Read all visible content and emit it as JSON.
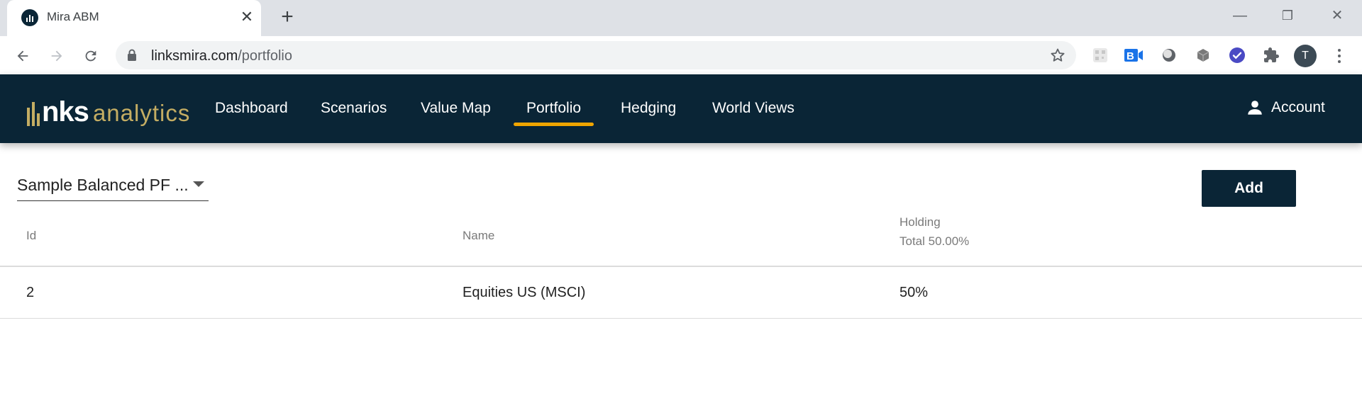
{
  "browser": {
    "tab_title": "Mira ABM",
    "tab_close": "✕",
    "new_tab": "+",
    "url_host": "linksmira.com",
    "url_path": "/portfolio",
    "profile_initial": "T",
    "window_controls": {
      "minimize": "—",
      "restore": "❐",
      "close": "✕"
    },
    "extensions": [
      "qr-icon",
      "video-meeting-icon",
      "disc-icon",
      "cube-icon",
      "check-circle-icon",
      "puzzle-icon"
    ]
  },
  "app": {
    "logo": {
      "brand": "nks",
      "suffix": "analytics"
    },
    "nav": [
      {
        "label": "Dashboard"
      },
      {
        "label": "Scenarios"
      },
      {
        "label": "Value Map"
      },
      {
        "label": "Portfolio",
        "active": true
      },
      {
        "label": "Hedging"
      },
      {
        "label": "World Views"
      }
    ],
    "account_label": "Account",
    "colors": {
      "header_bg": "#0a2536",
      "accent": "#f0a500",
      "logo_gold": "#c4ad63"
    }
  },
  "portfolio": {
    "selected": "Sample Balanced PF ...",
    "add_label": "Add",
    "columns": {
      "id": "Id",
      "name": "Name",
      "holding": "Holding",
      "holding_total": "Total 50.00%"
    },
    "rows": [
      {
        "id": "2",
        "name": "Equities US (MSCI)",
        "holding": "50%"
      }
    ]
  }
}
